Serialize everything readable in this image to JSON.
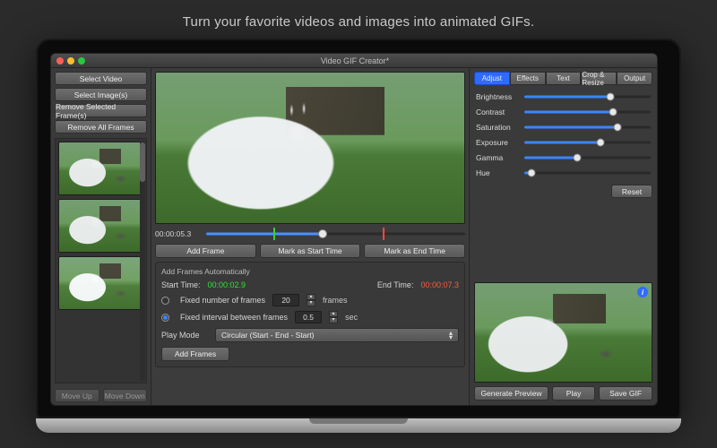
{
  "tagline": "Turn your favorite videos and images into animated GIFs.",
  "window": {
    "title": "Video GIF Creator*"
  },
  "sidebar": {
    "select_video": "Select Video",
    "select_images": "Select Image(s)",
    "remove_selected": "Remove Selected Frame(s)",
    "remove_all": "Remove All Frames",
    "move_up": "Move Up",
    "move_down": "Move Down"
  },
  "timeline": {
    "timecode": "00:00:05.3",
    "fill_pct": 45,
    "marker_start_pct": 26,
    "marker_end_pct": 68,
    "knob_pct": 45,
    "add_frame": "Add Frame",
    "mark_start": "Mark as Start Time",
    "mark_end": "Mark as End Time"
  },
  "auto": {
    "heading": "Add Frames Automatically",
    "start_label": "Start Time:",
    "start_value": "00:00:02.9",
    "end_label": "End Time:",
    "end_value": "00:00:07.3",
    "mode_fixed_n_label": "Fixed number of frames",
    "mode_fixed_n_value": "20",
    "mode_fixed_n_unit": "frames",
    "mode_fixed_int_label": "Fixed interval between frames",
    "mode_fixed_int_value": "0.5",
    "mode_fixed_int_unit": "sec",
    "selected_mode": "interval",
    "play_mode_label": "Play Mode",
    "play_mode_value": "Circular (Start - End - Start)",
    "add_frames_btn": "Add Frames"
  },
  "tabs": {
    "items": [
      "Adjust",
      "Effects",
      "Text",
      "Crop & Resize",
      "Output"
    ],
    "active_index": 0
  },
  "sliders": [
    {
      "label": "Brightness",
      "value": 68
    },
    {
      "label": "Contrast",
      "value": 70
    },
    {
      "label": "Saturation",
      "value": 74
    },
    {
      "label": "Exposure",
      "value": 60
    },
    {
      "label": "Gamma",
      "value": 42
    },
    {
      "label": "Hue",
      "value": 6
    }
  ],
  "reset_label": "Reset",
  "info_badge": "i",
  "output": {
    "generate": "Generate Preview",
    "play": "Play",
    "save": "Save GIF"
  }
}
